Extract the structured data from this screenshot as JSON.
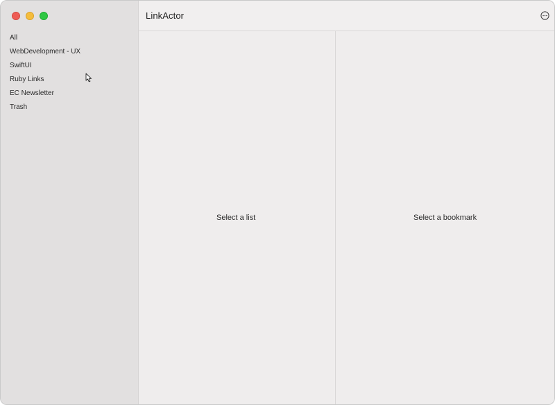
{
  "window": {
    "title": "LinkActor"
  },
  "sidebar": {
    "items": [
      {
        "label": "All"
      },
      {
        "label": "WebDevelopment - UX"
      },
      {
        "label": "SwiftUI"
      },
      {
        "label": "Ruby Links"
      },
      {
        "label": "EC Newsletter"
      },
      {
        "label": "Trash"
      }
    ]
  },
  "toolbar": {
    "more_icon": "ellipsis-circle-icon"
  },
  "list_pane": {
    "placeholder": "Select a list"
  },
  "detail_pane": {
    "placeholder": "Select a bookmark"
  },
  "colors": {
    "close": "#ee5c55",
    "minimize": "#f5bd3c",
    "maximize": "#2fc743",
    "sidebar_bg": "#e2e0e0",
    "content_bg": "#efeded"
  }
}
